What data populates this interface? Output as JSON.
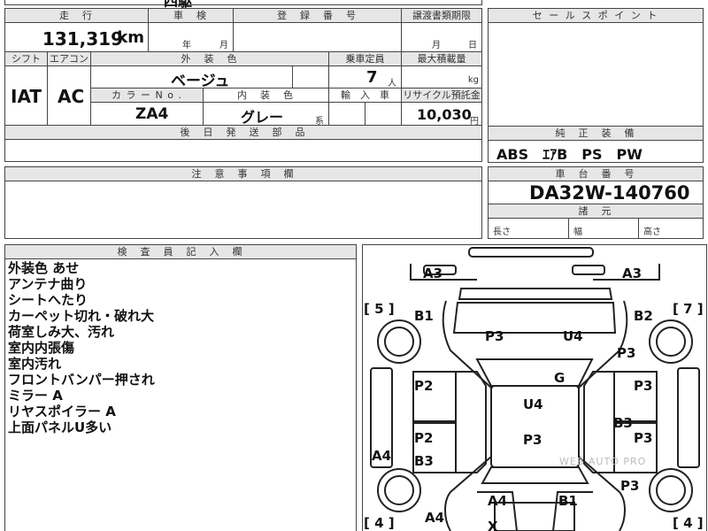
{
  "top_row": {
    "cut_text": "四駆"
  },
  "mileage": {
    "header": "走　行",
    "value": "131,319",
    "unit": "km"
  },
  "shaken": {
    "header": "車　検",
    "year": "年",
    "month": "月"
  },
  "registration": {
    "header": "登　録　番　号"
  },
  "transfer_deadline": {
    "header": "譲渡書類期限",
    "month": "月",
    "day": "日"
  },
  "sales_point": {
    "header": "セ ー ル ス ポ イ ン ト"
  },
  "shift": {
    "header": "シフト",
    "value": "IAT"
  },
  "aircon": {
    "header": "エアコン",
    "value": "AC"
  },
  "exterior_color": {
    "header": "外　装　色",
    "value": "ベージュ"
  },
  "capacity": {
    "header": "乗車定員",
    "value": "7",
    "unit": "人"
  },
  "max_load": {
    "header": "最大積載量",
    "unit": "kg"
  },
  "color_no": {
    "header": "カ ラ ー N o .",
    "value": "ZA4"
  },
  "interior_color": {
    "header": "内　装　色",
    "value": "グレー",
    "suffix": "系"
  },
  "import": {
    "header": "輸　入　車"
  },
  "recycle": {
    "header": "リサイクル預託金",
    "value": "10,030",
    "unit": "円"
  },
  "later_parts": {
    "header": "後　日　発　送　部　品"
  },
  "equipment": {
    "header": "純　正　装　備",
    "value": "ABS　ｴｱB　PS　PW"
  },
  "caution": {
    "header": "注　意　事　項　欄"
  },
  "chassis": {
    "header": "車　台　番　号",
    "value": "DA32W-140760"
  },
  "dimensions": {
    "header": "諸　元",
    "length": "長さ",
    "width": "幅",
    "height": "高さ"
  },
  "inspector": {
    "header": "検　査　員　記　入　欄",
    "notes": [
      "外装色 あせ",
      "アンテナ曲り",
      "シートへたり",
      "カーペット切れ・破れ大",
      "荷室しみ大、汚れ",
      "室内内張傷",
      "室内汚れ",
      "フロントバンパー押され",
      "ミラー A",
      "リヤスポイラー A",
      "上面パネルU多い"
    ]
  },
  "diagram": {
    "marks": [
      "A3",
      "A3",
      "B1",
      "B2",
      "P3",
      "U4",
      "P3",
      "P2",
      "G",
      "P3",
      "U4",
      "B3",
      "P2",
      "P3",
      "P3",
      "B3",
      "A4",
      "P3",
      "A4",
      "B1",
      "A4",
      "X"
    ],
    "brackets": [
      "[ 5 ]",
      "[ 7 ]",
      "[ 4 ]",
      "[ 4 ]"
    ],
    "watermark": "WEB AUTO PRO"
  }
}
